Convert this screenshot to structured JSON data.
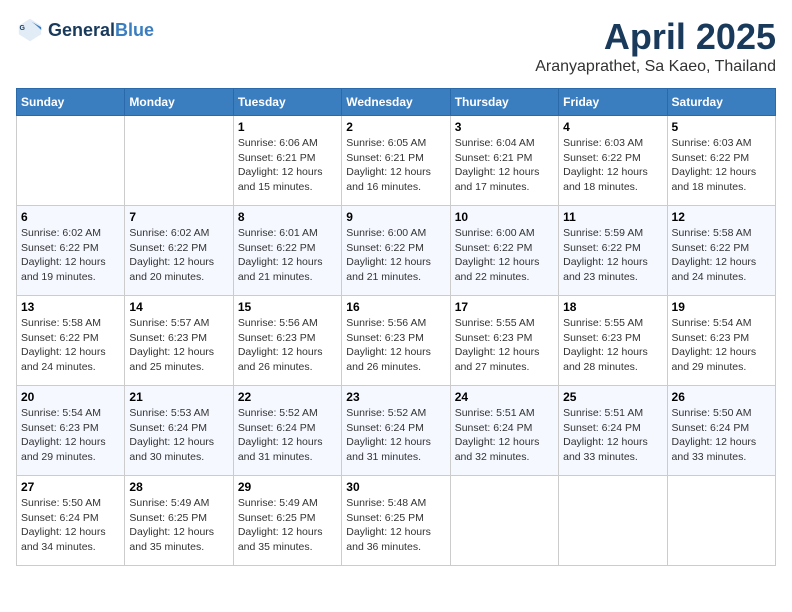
{
  "header": {
    "logo_general": "General",
    "logo_blue": "Blue",
    "title": "April 2025",
    "location": "Aranyaprathet, Sa Kaeo, Thailand"
  },
  "weekdays": [
    "Sunday",
    "Monday",
    "Tuesday",
    "Wednesday",
    "Thursday",
    "Friday",
    "Saturday"
  ],
  "weeks": [
    [
      {
        "day": "",
        "info": ""
      },
      {
        "day": "",
        "info": ""
      },
      {
        "day": "1",
        "info": "Sunrise: 6:06 AM\nSunset: 6:21 PM\nDaylight: 12 hours and 15 minutes."
      },
      {
        "day": "2",
        "info": "Sunrise: 6:05 AM\nSunset: 6:21 PM\nDaylight: 12 hours and 16 minutes."
      },
      {
        "day": "3",
        "info": "Sunrise: 6:04 AM\nSunset: 6:21 PM\nDaylight: 12 hours and 17 minutes."
      },
      {
        "day": "4",
        "info": "Sunrise: 6:03 AM\nSunset: 6:22 PM\nDaylight: 12 hours and 18 minutes."
      },
      {
        "day": "5",
        "info": "Sunrise: 6:03 AM\nSunset: 6:22 PM\nDaylight: 12 hours and 18 minutes."
      }
    ],
    [
      {
        "day": "6",
        "info": "Sunrise: 6:02 AM\nSunset: 6:22 PM\nDaylight: 12 hours and 19 minutes."
      },
      {
        "day": "7",
        "info": "Sunrise: 6:02 AM\nSunset: 6:22 PM\nDaylight: 12 hours and 20 minutes."
      },
      {
        "day": "8",
        "info": "Sunrise: 6:01 AM\nSunset: 6:22 PM\nDaylight: 12 hours and 21 minutes."
      },
      {
        "day": "9",
        "info": "Sunrise: 6:00 AM\nSunset: 6:22 PM\nDaylight: 12 hours and 21 minutes."
      },
      {
        "day": "10",
        "info": "Sunrise: 6:00 AM\nSunset: 6:22 PM\nDaylight: 12 hours and 22 minutes."
      },
      {
        "day": "11",
        "info": "Sunrise: 5:59 AM\nSunset: 6:22 PM\nDaylight: 12 hours and 23 minutes."
      },
      {
        "day": "12",
        "info": "Sunrise: 5:58 AM\nSunset: 6:22 PM\nDaylight: 12 hours and 24 minutes."
      }
    ],
    [
      {
        "day": "13",
        "info": "Sunrise: 5:58 AM\nSunset: 6:22 PM\nDaylight: 12 hours and 24 minutes."
      },
      {
        "day": "14",
        "info": "Sunrise: 5:57 AM\nSunset: 6:23 PM\nDaylight: 12 hours and 25 minutes."
      },
      {
        "day": "15",
        "info": "Sunrise: 5:56 AM\nSunset: 6:23 PM\nDaylight: 12 hours and 26 minutes."
      },
      {
        "day": "16",
        "info": "Sunrise: 5:56 AM\nSunset: 6:23 PM\nDaylight: 12 hours and 26 minutes."
      },
      {
        "day": "17",
        "info": "Sunrise: 5:55 AM\nSunset: 6:23 PM\nDaylight: 12 hours and 27 minutes."
      },
      {
        "day": "18",
        "info": "Sunrise: 5:55 AM\nSunset: 6:23 PM\nDaylight: 12 hours and 28 minutes."
      },
      {
        "day": "19",
        "info": "Sunrise: 5:54 AM\nSunset: 6:23 PM\nDaylight: 12 hours and 29 minutes."
      }
    ],
    [
      {
        "day": "20",
        "info": "Sunrise: 5:54 AM\nSunset: 6:23 PM\nDaylight: 12 hours and 29 minutes."
      },
      {
        "day": "21",
        "info": "Sunrise: 5:53 AM\nSunset: 6:24 PM\nDaylight: 12 hours and 30 minutes."
      },
      {
        "day": "22",
        "info": "Sunrise: 5:52 AM\nSunset: 6:24 PM\nDaylight: 12 hours and 31 minutes."
      },
      {
        "day": "23",
        "info": "Sunrise: 5:52 AM\nSunset: 6:24 PM\nDaylight: 12 hours and 31 minutes."
      },
      {
        "day": "24",
        "info": "Sunrise: 5:51 AM\nSunset: 6:24 PM\nDaylight: 12 hours and 32 minutes."
      },
      {
        "day": "25",
        "info": "Sunrise: 5:51 AM\nSunset: 6:24 PM\nDaylight: 12 hours and 33 minutes."
      },
      {
        "day": "26",
        "info": "Sunrise: 5:50 AM\nSunset: 6:24 PM\nDaylight: 12 hours and 33 minutes."
      }
    ],
    [
      {
        "day": "27",
        "info": "Sunrise: 5:50 AM\nSunset: 6:24 PM\nDaylight: 12 hours and 34 minutes."
      },
      {
        "day": "28",
        "info": "Sunrise: 5:49 AM\nSunset: 6:25 PM\nDaylight: 12 hours and 35 minutes."
      },
      {
        "day": "29",
        "info": "Sunrise: 5:49 AM\nSunset: 6:25 PM\nDaylight: 12 hours and 35 minutes."
      },
      {
        "day": "30",
        "info": "Sunrise: 5:48 AM\nSunset: 6:25 PM\nDaylight: 12 hours and 36 minutes."
      },
      {
        "day": "",
        "info": ""
      },
      {
        "day": "",
        "info": ""
      },
      {
        "day": "",
        "info": ""
      }
    ]
  ]
}
